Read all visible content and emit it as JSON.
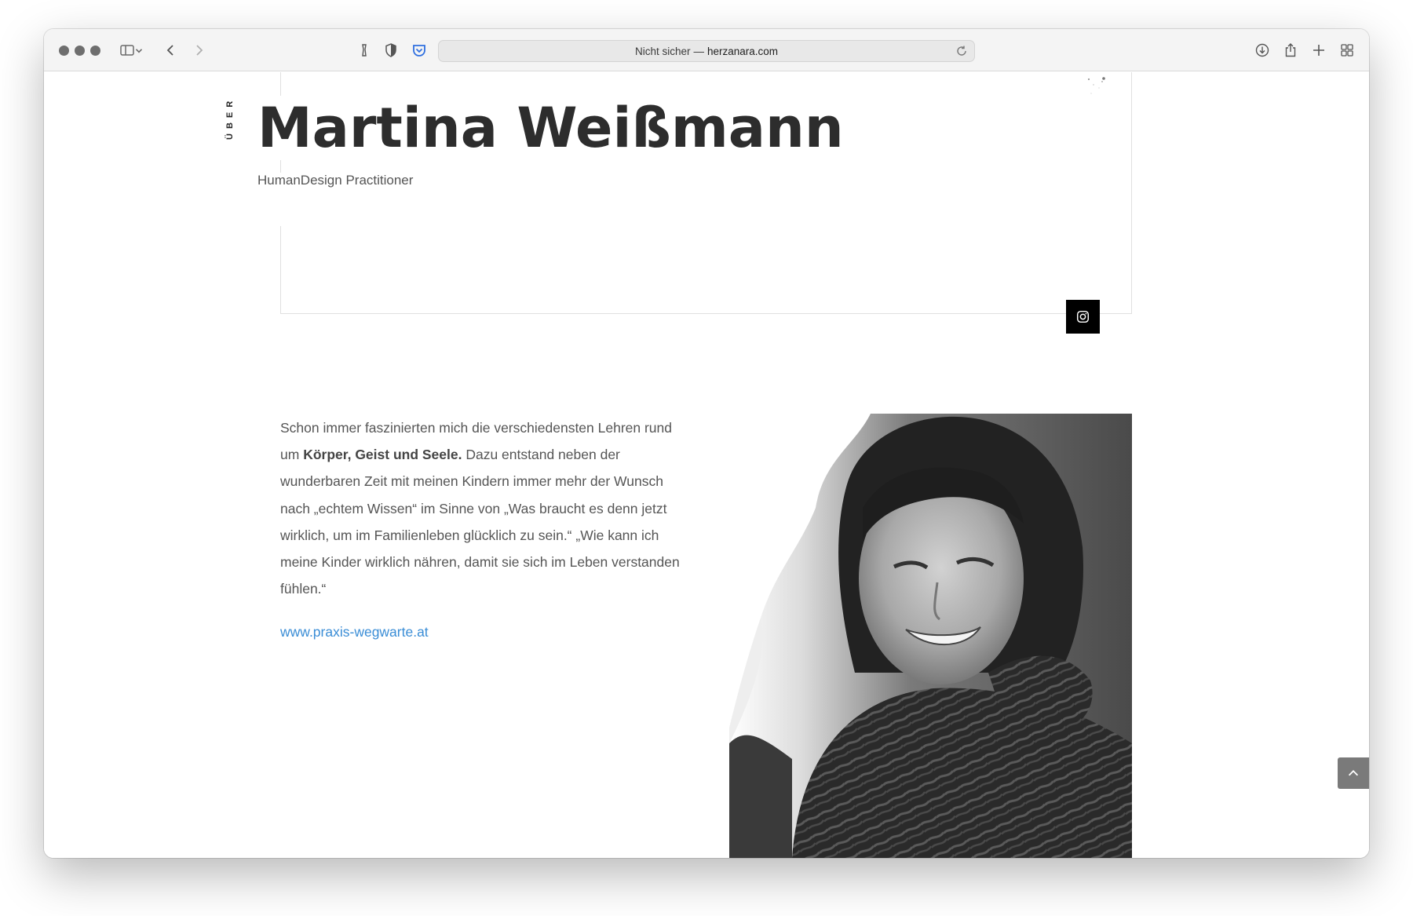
{
  "browser": {
    "address": {
      "security": "Nicht sicher",
      "separator": "—",
      "domain": "herzanara.com"
    }
  },
  "page": {
    "section_label": "ÜBER",
    "title": "Martina Weißmann",
    "subtitle": "HumanDesign Practitioner",
    "bio": {
      "part1": "Schon immer faszinierten mich die verschiedensten Lehren rund um ",
      "bold": "Körper, Geist und Seele.",
      "part2": " Dazu entstand neben der wunderbaren Zeit mit meinen Kindern immer mehr der Wunsch nach „echtem Wissen“ im Sinne von „Was braucht es denn jetzt wirklich, um im Familienleben glücklich zu sein.“ „Wie kann ich meine Kinder wirklich nähren, damit sie sich im Leben verstanden fühlen.“"
    },
    "link": "www.praxis-wegwarte.at",
    "icons": {
      "social": "instagram-icon",
      "scroll": "chevron-up-icon"
    },
    "colors": {
      "link": "#3a8dd6",
      "title": "#2d2d2d",
      "social_bg": "#000000"
    }
  }
}
